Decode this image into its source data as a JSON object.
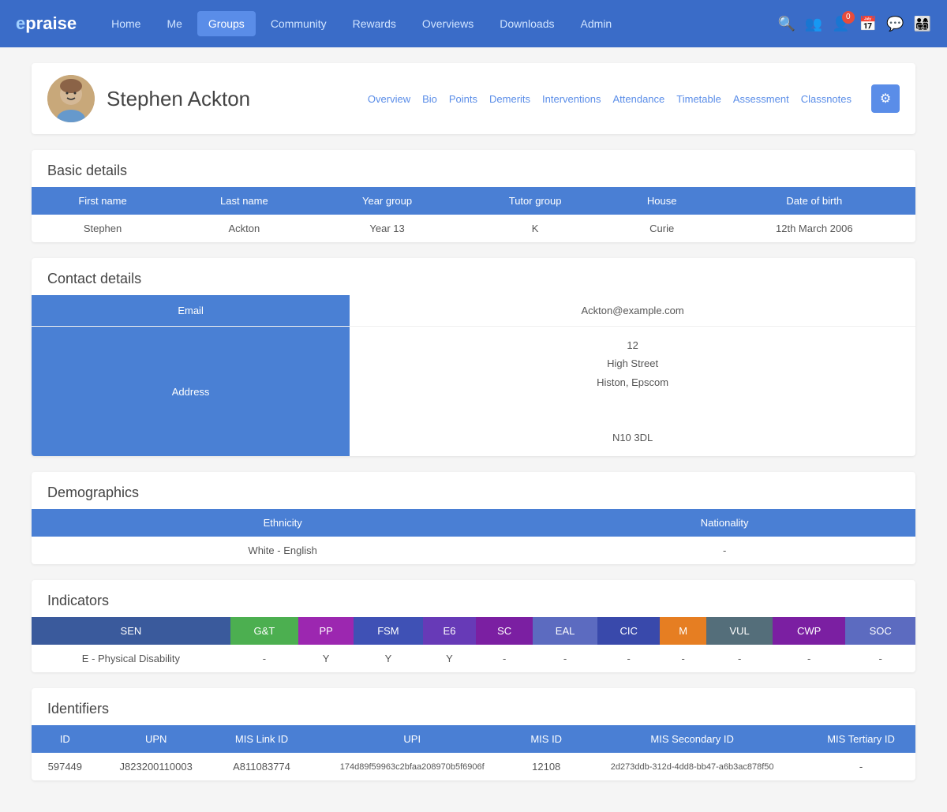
{
  "brand": {
    "e": "e",
    "praise": "praise"
  },
  "nav": {
    "links": [
      {
        "label": "Home",
        "active": false
      },
      {
        "label": "Me",
        "active": false
      },
      {
        "label": "Groups",
        "active": true
      },
      {
        "label": "Community",
        "active": false
      },
      {
        "label": "Rewards",
        "active": false
      },
      {
        "label": "Overviews",
        "active": false
      },
      {
        "label": "Downloads",
        "active": false
      },
      {
        "label": "Admin",
        "active": false
      }
    ],
    "badge_count": "0"
  },
  "profile": {
    "name": "Stephen Ackton",
    "tabs": [
      "Overview",
      "Bio",
      "Points",
      "Demerits",
      "Interventions",
      "Attendance",
      "Timetable",
      "Assessment",
      "Classnotes"
    ]
  },
  "basic_details": {
    "title": "Basic details",
    "headers": [
      "First name",
      "Last name",
      "Year group",
      "Tutor group",
      "House",
      "Date of birth"
    ],
    "row": [
      "Stephen",
      "Ackton",
      "Year 13",
      "K",
      "Curie",
      "12th March 2006"
    ]
  },
  "contact_details": {
    "title": "Contact details",
    "email_label": "Email",
    "email_value": "Ackton@example.com",
    "address_label": "Address",
    "address_lines": [
      "12",
      "High Street",
      "Histon, Epscom",
      "",
      "",
      "N10 3DL"
    ]
  },
  "demographics": {
    "title": "Demographics",
    "headers": [
      "Ethnicity",
      "Nationality"
    ],
    "row": [
      "White - English",
      "-"
    ]
  },
  "indicators": {
    "title": "Indicators",
    "headers": [
      {
        "label": "SEN",
        "class": "ind-sen"
      },
      {
        "label": "G&T",
        "class": "ind-gt"
      },
      {
        "label": "PP",
        "class": "ind-pp"
      },
      {
        "label": "FSM",
        "class": "ind-fsm"
      },
      {
        "label": "E6",
        "class": "ind-e6"
      },
      {
        "label": "SC",
        "class": "ind-sc"
      },
      {
        "label": "EAL",
        "class": "ind-eal"
      },
      {
        "label": "CIC",
        "class": "ind-cic"
      },
      {
        "label": "M",
        "class": "ind-m"
      },
      {
        "label": "VUL",
        "class": "ind-vul"
      },
      {
        "label": "CWP",
        "class": "ind-cwp"
      },
      {
        "label": "SOC",
        "class": "ind-soc"
      }
    ],
    "row": [
      "E - Physical Disability",
      "-",
      "Y",
      "Y",
      "Y",
      "-",
      "-",
      "-",
      "-",
      "-",
      "-",
      "-"
    ]
  },
  "identifiers": {
    "title": "Identifiers",
    "headers": [
      "ID",
      "UPN",
      "MIS Link ID",
      "UPI",
      "MIS ID",
      "MIS Secondary ID",
      "MIS Tertiary ID"
    ],
    "row": [
      "597449",
      "J823200110003",
      "A811083774",
      "174d89f59963c2bfaa208970b5f6906f",
      "12108",
      "2d273ddb-312d-4dd8-bb47-a6b3ac878f50",
      "-"
    ]
  }
}
